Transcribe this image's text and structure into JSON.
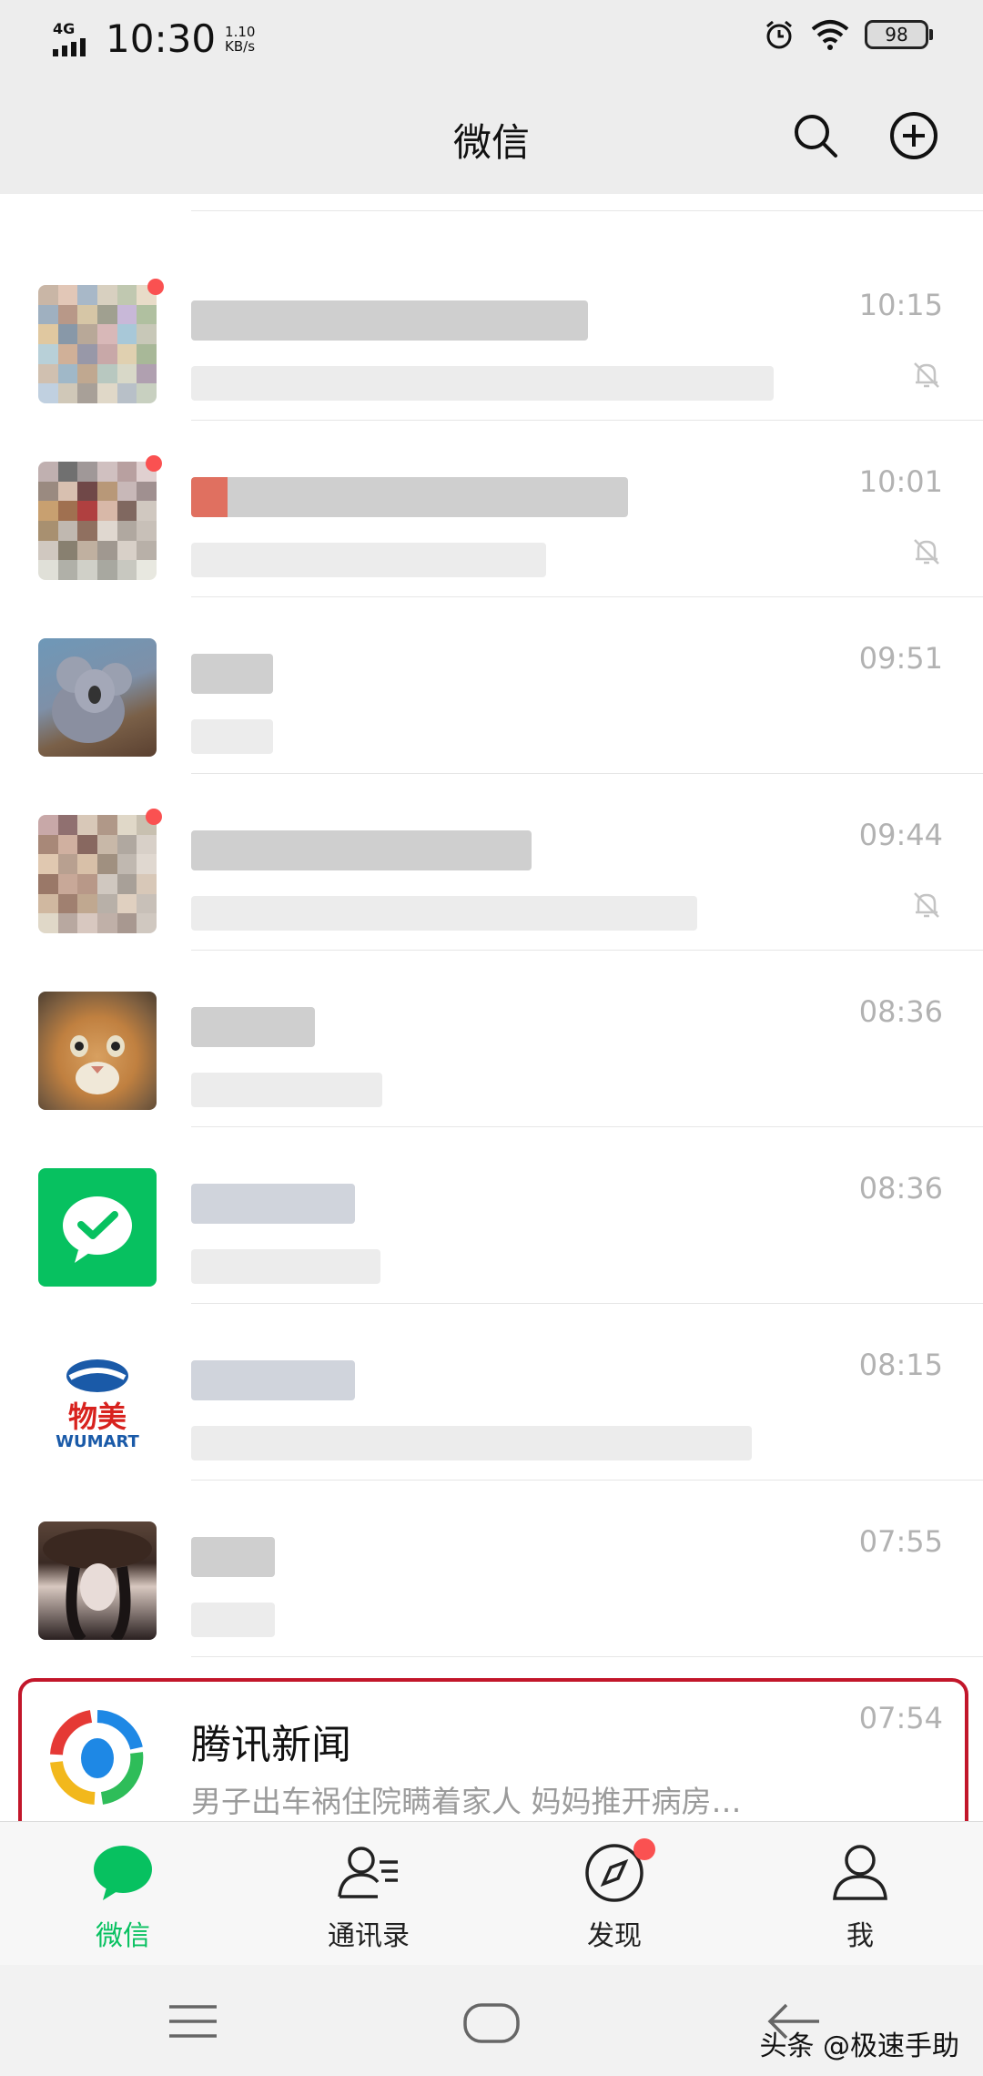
{
  "status_bar": {
    "network": "4G",
    "time": "10:30",
    "speed_value": "1.10",
    "speed_unit": "KB/s",
    "battery": "98",
    "icons": [
      "alarm-icon",
      "wifi-icon",
      "battery-icon"
    ]
  },
  "header": {
    "title": "微信",
    "actions": [
      "search-icon",
      "add-icon"
    ]
  },
  "chats": [
    {
      "time": "10:15",
      "muted": true,
      "has_badge": true
    },
    {
      "time": "10:01",
      "muted": true,
      "has_badge": true
    },
    {
      "time": "09:51",
      "muted": false,
      "has_badge": false
    },
    {
      "time": "09:44",
      "muted": true,
      "has_badge": true
    },
    {
      "time": "08:36",
      "muted": false,
      "has_badge": false
    },
    {
      "time": "08:36",
      "muted": false,
      "has_badge": false
    },
    {
      "time": "08:15",
      "muted": false,
      "has_badge": false,
      "avatar_text_top": "物美",
      "avatar_text_bottom": "WUMART"
    },
    {
      "time": "07:55",
      "muted": false,
      "has_badge": false,
      "highlighted": true
    },
    {
      "name": "腾讯新闻",
      "preview": "男子出车祸住院瞒着家人 妈妈推开病房…",
      "time": "07:54",
      "muted": false,
      "has_badge": false
    }
  ],
  "tabs": [
    {
      "label": "微信",
      "icon": "chat-bubble-icon",
      "active": true
    },
    {
      "label": "通讯录",
      "icon": "contacts-icon",
      "active": false
    },
    {
      "label": "发现",
      "icon": "compass-icon",
      "active": false,
      "badge": true
    },
    {
      "label": "我",
      "icon": "person-icon",
      "active": false
    }
  ],
  "system_nav": [
    "menu-icon",
    "home-icon",
    "back-icon"
  ],
  "watermark": "头条 @极速手助",
  "colors": {
    "accent": "#07c160",
    "badge": "#fa5151",
    "highlight": "#c2162a"
  }
}
